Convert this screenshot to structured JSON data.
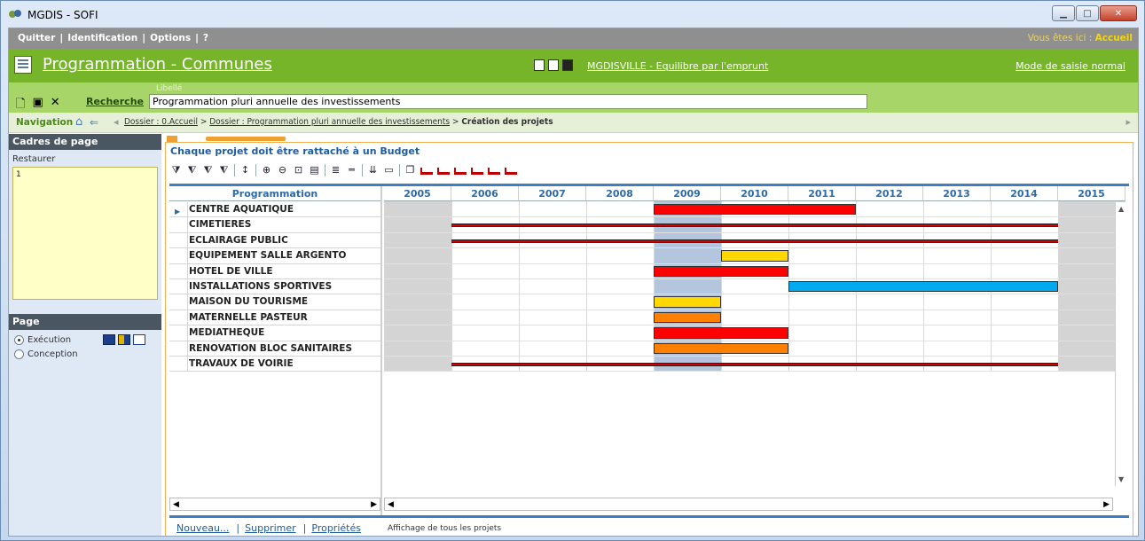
{
  "window": {
    "title": "MGDIS - SOFI"
  },
  "menu": {
    "items": [
      "Quitter",
      "Identification",
      "Options",
      "?"
    ],
    "here_label": "Vous êtes ici :",
    "here_value": "Accueil"
  },
  "header": {
    "title": "Programmation - Communes",
    "context_link": "MGDISVILLE - Equilibre par l'emprunt",
    "mode_link": "Mode de saisie normal"
  },
  "search": {
    "label": "Recherche",
    "field_label": "Libellé",
    "value": "Programmation pluri annuelle des investissements"
  },
  "navigation": {
    "label": "Navigation",
    "crumbs": [
      "Dossier : 0.Accueil",
      "Dossier : Programmation pluri annuelle des investissements"
    ],
    "current": "Création des projets"
  },
  "sidebar": {
    "cadres_title": "Cadres de page",
    "restore_label": "Restaurer",
    "cadre_item": "1",
    "page_title": "Page",
    "modes": [
      {
        "label": "Exécution",
        "selected": true
      },
      {
        "label": "Conception",
        "selected": false
      }
    ]
  },
  "main": {
    "message": "Chaque projet doit être rattaché à un Budget",
    "column_header": "Programmation",
    "years": [
      "2005",
      "2006",
      "2007",
      "2008",
      "2009",
      "2010",
      "2011",
      "2012",
      "2013",
      "2014",
      "2015"
    ],
    "current_year": "2009",
    "projects": [
      {
        "name": "CENTRE AQUATIQUE",
        "start": 2009,
        "end": 2012.0,
        "color": "#ff0000",
        "style": "bar"
      },
      {
        "name": "CIMETIERES",
        "start": 2006,
        "end": 2015,
        "color": "#d40000",
        "style": "thin"
      },
      {
        "name": "ECLAIRAGE PUBLIC",
        "start": 2006,
        "end": 2015,
        "color": "#d40000",
        "style": "thin"
      },
      {
        "name": "EQUIPEMENT SALLE ARGENTO",
        "start": 2010,
        "end": 2011,
        "color": "#ffd800",
        "style": "bar"
      },
      {
        "name": "HOTEL DE VILLE",
        "start": 2009,
        "end": 2011.0,
        "color": "#ff0000",
        "style": "bar"
      },
      {
        "name": "INSTALLATIONS SPORTIVES",
        "start": 2011,
        "end": 2015,
        "color": "#00aaee",
        "style": "bar"
      },
      {
        "name": "MAISON DU TOURISME",
        "start": 2009,
        "end": 2010,
        "color": "#ffd800",
        "style": "bar"
      },
      {
        "name": "MATERNELLE PASTEUR",
        "start": 2009,
        "end": 2010,
        "color": "#ff8000",
        "style": "bar"
      },
      {
        "name": "MEDIATHEQUE",
        "start": 2009,
        "end": 2011.0,
        "color": "#ff0000",
        "style": "bar"
      },
      {
        "name": "RENOVATION BLOC SANITAIRES",
        "start": 2009,
        "end": 2011,
        "color": "#ff8000",
        "style": "bar"
      },
      {
        "name": "TRAVAUX DE VOIRIE",
        "start": 2006,
        "end": 2015,
        "color": "#d40000",
        "style": "thin"
      }
    ]
  },
  "footer": {
    "new_label": "Nouveau...",
    "delete_label": "Supprimer",
    "props_label": "Propriétés",
    "info": "Affichage de tous les projets"
  }
}
